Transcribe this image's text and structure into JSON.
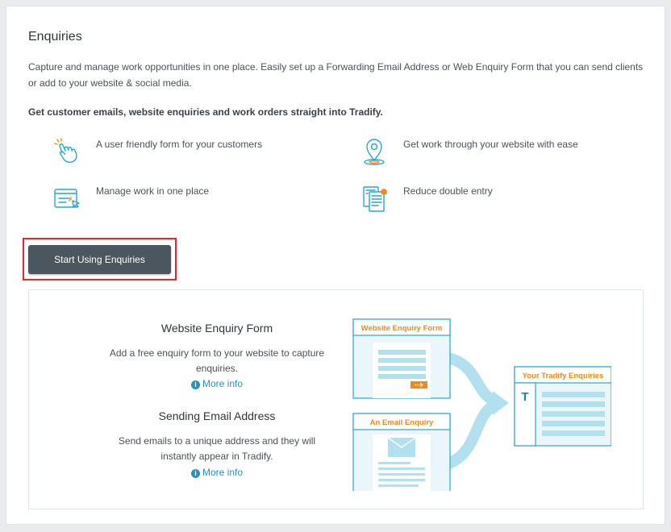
{
  "page": {
    "title": "Enquiries",
    "description": "Capture and manage work opportunities in one place. Easily set up a Forwarding Email Address or Web Enquiry Form that you can send clients or add to your website & social media.",
    "subheading": "Get customer emails, website enquiries and work orders straight into Tradify."
  },
  "features": [
    {
      "label": "A user friendly form for your customers",
      "icon": "hand-pointer-icon"
    },
    {
      "label": "Get work through your website with ease",
      "icon": "map-pin-icon"
    },
    {
      "label": "Manage work in one place",
      "icon": "browser-cursor-icon"
    },
    {
      "label": "Reduce double entry",
      "icon": "documents-icon"
    }
  ],
  "cta": {
    "label": "Start Using Enquiries"
  },
  "panel": {
    "form": {
      "title": "Website Enquiry Form",
      "text_line1": "Add a free enquiry form to your website to capture",
      "text_line2": "enquiries.",
      "more": "More info"
    },
    "email": {
      "title": "Sending Email Address",
      "text_line1": "Send emails to a unique address and they will",
      "text_line2": "instantly appear in Tradify.",
      "more": "More info"
    },
    "diagram": {
      "form_card": "Website Enquiry Form",
      "email_card": "An Email Enquiry",
      "result_card": "Your Tradify Enquiries",
      "brand_letter": "T"
    }
  },
  "colors": {
    "accent_orange": "#f08a1c",
    "accent_blue": "#2b8fbf",
    "button": "#4c565e",
    "highlight": "#e8262b",
    "diagram_blue": "#b3e0ee"
  }
}
